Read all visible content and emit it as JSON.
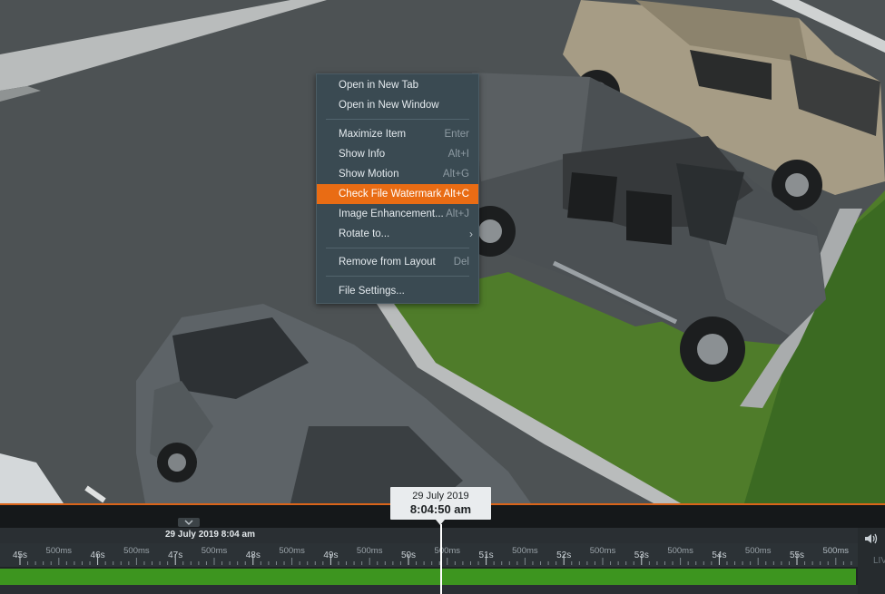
{
  "context_menu": {
    "items": [
      {
        "label": "Open in New Tab",
        "shortcut": ""
      },
      {
        "label": "Open in New Window",
        "shortcut": ""
      },
      {
        "label": "Maximize Item",
        "shortcut": "Enter"
      },
      {
        "label": "Show Info",
        "shortcut": "Alt+I"
      },
      {
        "label": "Show Motion",
        "shortcut": "Alt+G"
      },
      {
        "label": "Check File Watermark",
        "shortcut": "Alt+C",
        "highlighted": true
      },
      {
        "label": "Image Enhancement...",
        "shortcut": "Alt+J"
      },
      {
        "label": "Rotate to...",
        "shortcut": "",
        "submenu": true
      },
      {
        "label": "Remove from Layout",
        "shortcut": "Del"
      },
      {
        "label": "File Settings...",
        "shortcut": ""
      }
    ],
    "highlight_color": "#e96c14"
  },
  "timeline": {
    "date_label": "29 July 2019 8:04 am",
    "cursor_date": "29 July 2019",
    "cursor_time": "8:04:50 am",
    "major_ticks": [
      "45s",
      "46s",
      "47s",
      "48s",
      "49s",
      "50s",
      "51s",
      "52s",
      "53s",
      "54s",
      "55s"
    ],
    "minor_label": "500ms",
    "live_label": "LIVE",
    "recording_color": "#3d951f"
  }
}
